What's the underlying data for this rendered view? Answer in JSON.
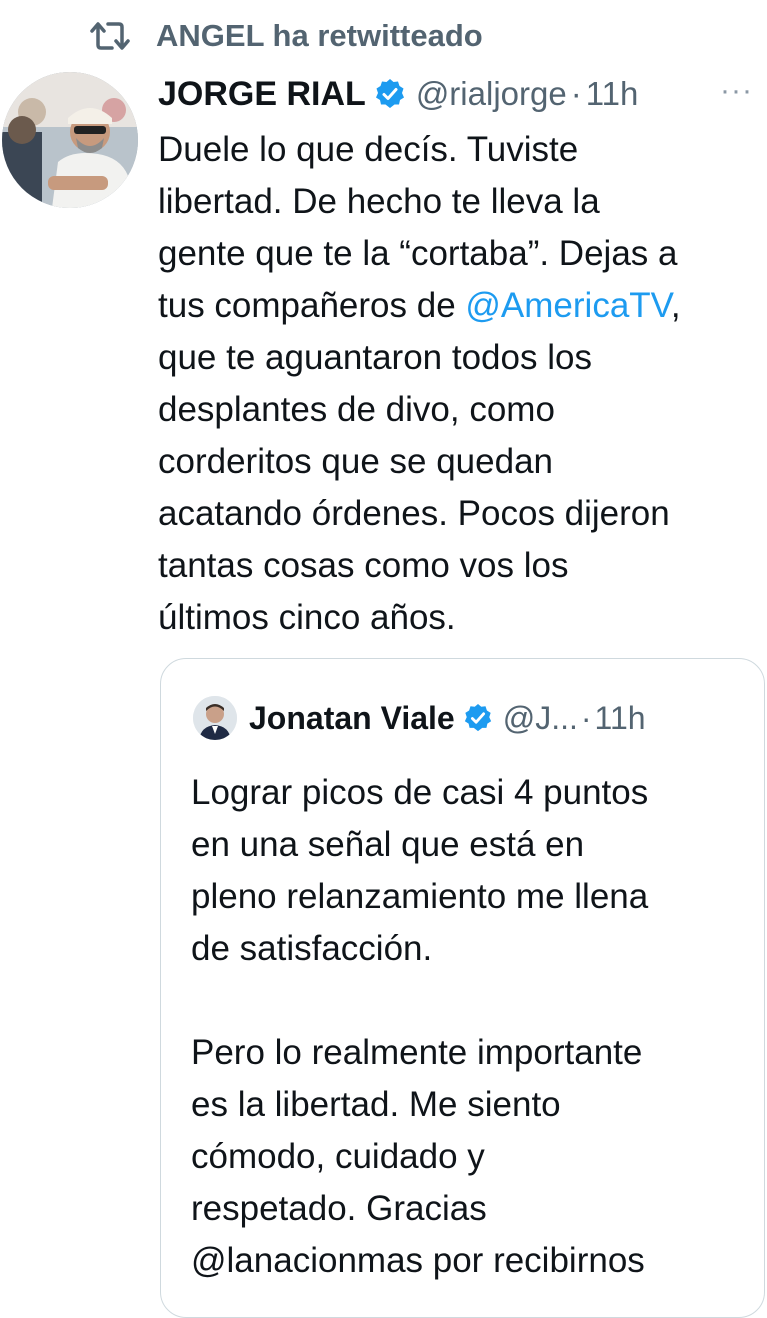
{
  "retweet": {
    "icon": "retweet-icon",
    "text": "ANGEL ha retwitteado"
  },
  "tweet": {
    "display_name": "JORGE RIAL",
    "handle": "@rialjorge",
    "separator": "·",
    "time": "11h",
    "more": "···",
    "lines": [
      "Duele lo que decís. Tuviste",
      "libertad. De hecho te lleva la",
      "gente que te la “cortaba”. Dejas a",
      "tus compañeros de ",
      "que te aguantaron todos los",
      "desplantes de divo, como",
      "corderitos que se quedan",
      "acatando órdenes. Pocos dijeron",
      "tantas cosas como vos los",
      "últimos cinco años."
    ],
    "mention": "@AmericaTV",
    "mention_suffix": ","
  },
  "quote": {
    "display_name": "Jonatan Viale",
    "handle": "@J...",
    "separator": "·",
    "time": "11h",
    "lines": [
      "Lograr picos de casi 4 puntos",
      "en una señal que está en",
      "pleno relanzamiento me llena",
      "de satisfacción.",
      "Pero lo realmente importante",
      "es la libertad. Me siento",
      "cómodo, cuidado y",
      "respetado. Gracias",
      "@lanacionmas por recibirnos"
    ]
  },
  "colors": {
    "accent": "#1d9bf0",
    "secondary_text": "#536471",
    "border": "#cfd9de"
  }
}
